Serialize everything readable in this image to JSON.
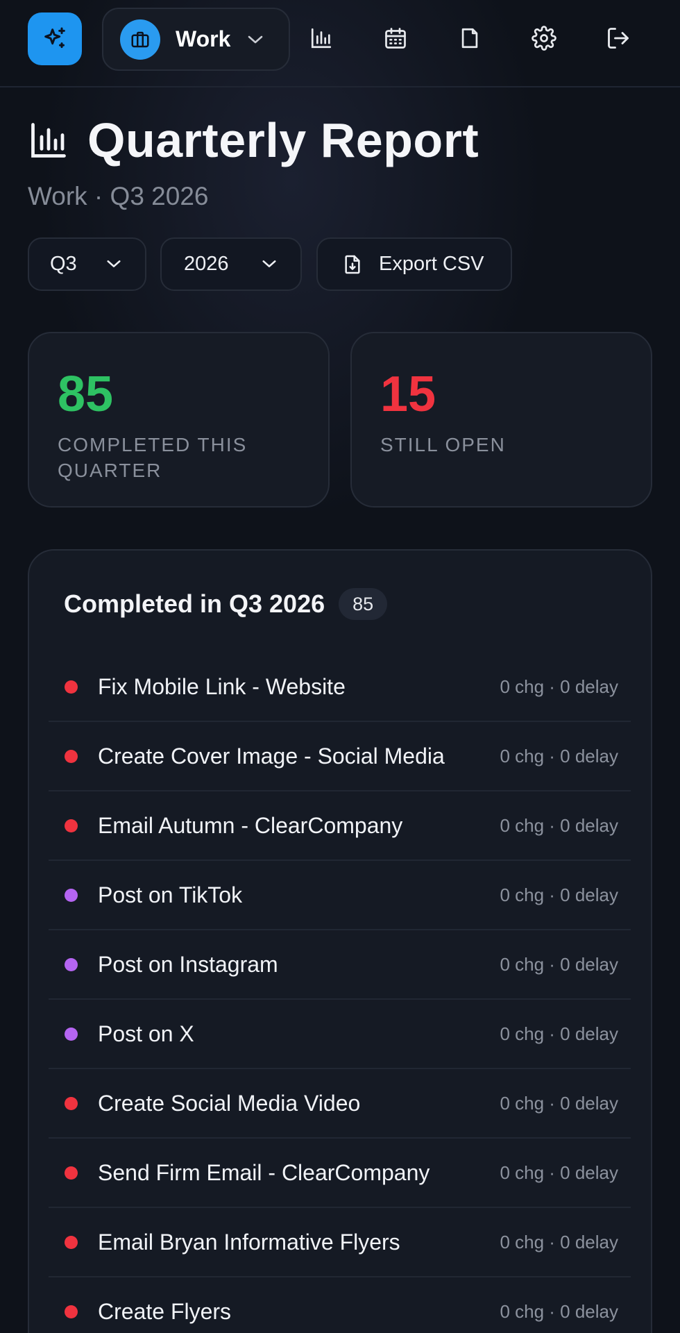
{
  "workspace": {
    "label": "Work"
  },
  "header": {
    "title": "Quarterly Report",
    "subtitle": "Work · Q3 2026"
  },
  "filters": {
    "quarter": "Q3",
    "year": "2026",
    "export_label": "Export CSV"
  },
  "stats": {
    "completed": {
      "value": "85",
      "label": "COMPLETED THIS QUARTER"
    },
    "open": {
      "value": "15",
      "label": "STILL OPEN"
    }
  },
  "completed_list": {
    "title": "Completed in Q3 2026",
    "count": "85",
    "items": [
      {
        "title": "Fix Mobile Link - Website",
        "meta": "0 chg · 0 delay",
        "color": "#f0333f"
      },
      {
        "title": "Create Cover Image - Social Media",
        "meta": "0 chg · 0 delay",
        "color": "#f0333f"
      },
      {
        "title": "Email Autumn - ClearCompany",
        "meta": "0 chg · 0 delay",
        "color": "#f0333f"
      },
      {
        "title": "Post on TikTok",
        "meta": "0 chg · 0 delay",
        "color": "#b565f2"
      },
      {
        "title": "Post on Instagram",
        "meta": "0 chg · 0 delay",
        "color": "#b565f2"
      },
      {
        "title": "Post on X",
        "meta": "0 chg · 0 delay",
        "color": "#b565f2"
      },
      {
        "title": "Create Social Media Video",
        "meta": "0 chg · 0 delay",
        "color": "#f0333f"
      },
      {
        "title": "Send Firm Email - ClearCompany",
        "meta": "0 chg · 0 delay",
        "color": "#f0333f"
      },
      {
        "title": "Email Bryan Informative Flyers",
        "meta": "0 chg · 0 delay",
        "color": "#f0333f"
      },
      {
        "title": "Create Flyers",
        "meta": "0 chg · 0 delay",
        "color": "#f0333f"
      }
    ]
  },
  "icons": {
    "logo": "sparkles-icon",
    "workspace": "briefcase-icon",
    "nav": [
      "bar-chart-icon",
      "calendar-icon",
      "file-icon",
      "gear-icon",
      "logout-icon"
    ]
  }
}
